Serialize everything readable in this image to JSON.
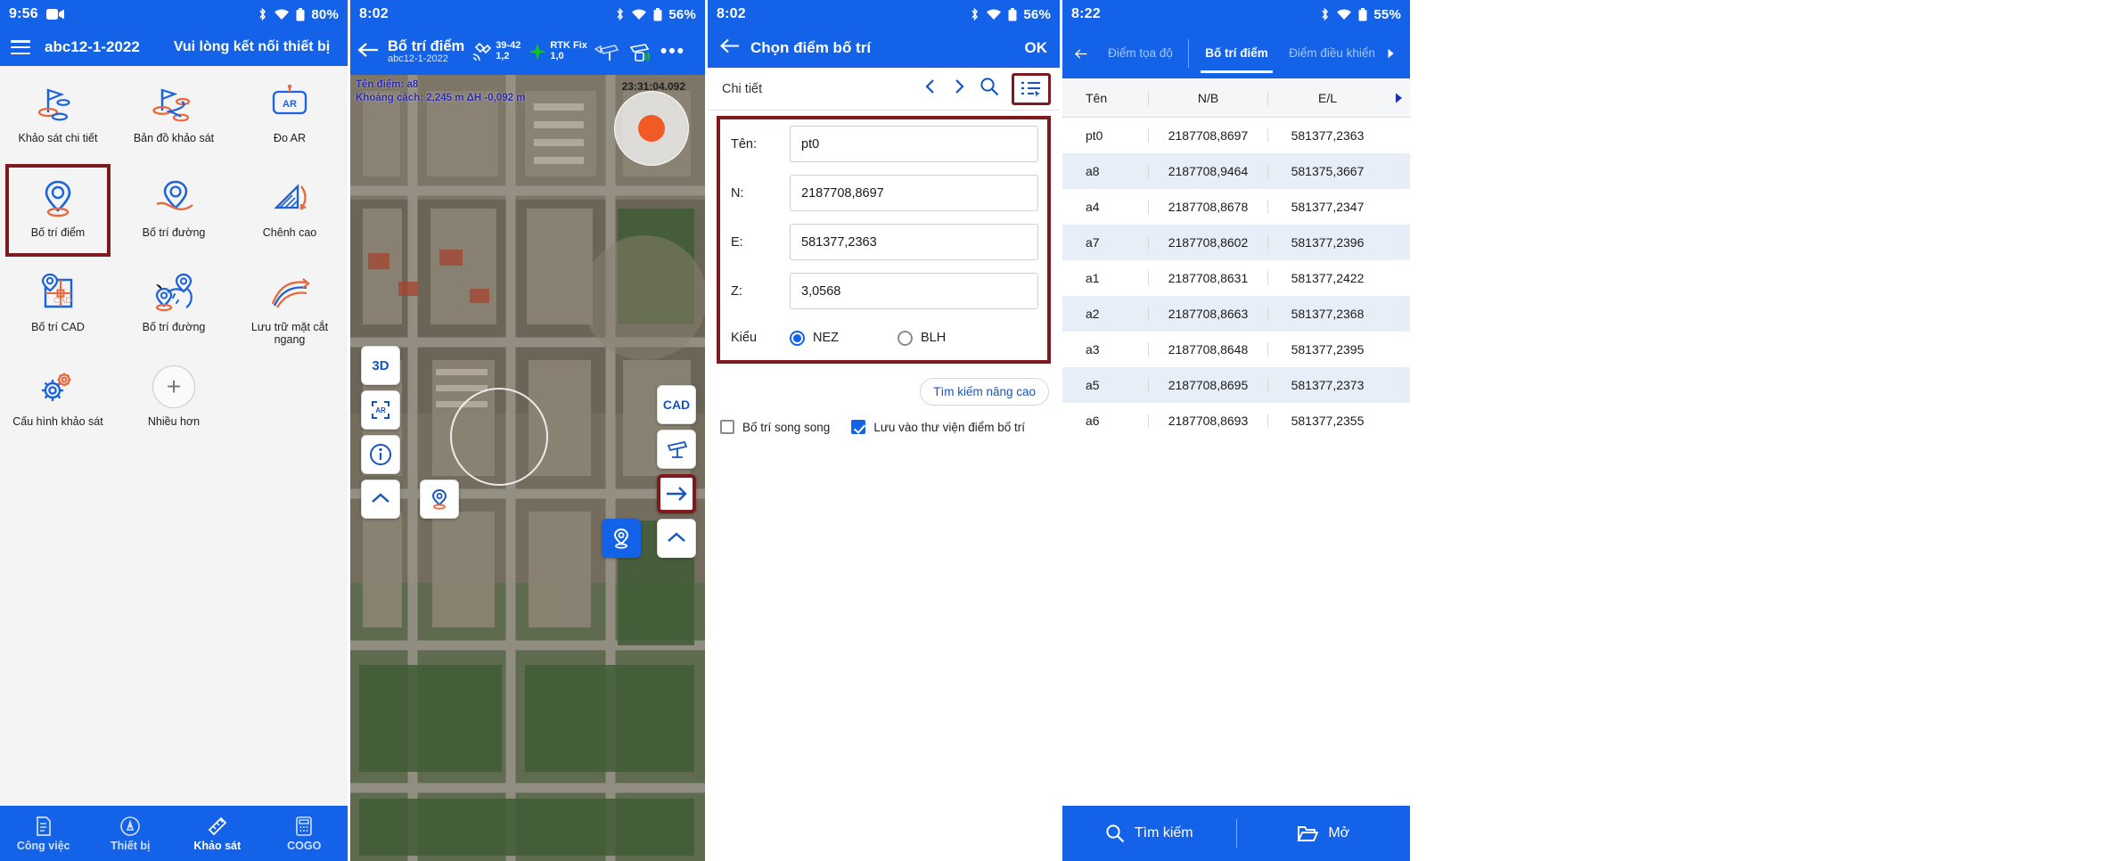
{
  "panel1": {
    "status": {
      "clock": "9:56",
      "battery": "80%",
      "rec_icon": "video-record-icon",
      "bt_icon": "bluetooth-icon",
      "wifi_icon": "wifi-icon",
      "battery_icon": "battery-icon"
    },
    "appbar": {
      "menu_icon": "hamburger-menu-icon",
      "project": "abc12-1-2022",
      "hint": "Vui lòng kết nối thiết bị"
    },
    "grid": [
      {
        "label": "Khảo sát chi tiết",
        "icon": "flag-survey-points-icon",
        "selected": false
      },
      {
        "label": "Bản đồ khảo sát",
        "icon": "flag-survey-map-icon",
        "selected": false
      },
      {
        "label": "Đo AR",
        "icon": "ar-measure-icon",
        "selected": false
      },
      {
        "label": "Bố trí điểm",
        "icon": "pin-stakeout-point-icon",
        "selected": true
      },
      {
        "label": "Bố trí đường",
        "icon": "pin-stakeout-line-icon",
        "selected": false
      },
      {
        "label": "Chênh cao",
        "icon": "elevation-difference-icon",
        "selected": false
      },
      {
        "label": "Bố trí CAD",
        "icon": "cad-stakeout-icon",
        "selected": false
      },
      {
        "label": "Bố trí đường",
        "icon": "road-stakeout-icon",
        "selected": false
      },
      {
        "label": "Lưu trữ mặt cắt ngang",
        "icon": "cross-section-storage-icon",
        "selected": false
      },
      {
        "label": "Cấu hình khảo sát",
        "icon": "gears-survey-config-icon",
        "selected": false
      },
      {
        "label": "Nhiều hơn",
        "icon": "plus-more-icon",
        "selected": false
      }
    ],
    "bottomnav": [
      {
        "label": "Công việc",
        "icon": "document-job-icon",
        "active": false
      },
      {
        "label": "Thiết bị",
        "icon": "device-antenna-icon",
        "active": false
      },
      {
        "label": "Khảo sát",
        "icon": "survey-ruler-icon",
        "active": true
      },
      {
        "label": "COGO",
        "icon": "cogo-calculator-icon",
        "active": false
      }
    ]
  },
  "panel2": {
    "status": {
      "clock": "8:02",
      "battery": "56%"
    },
    "appbar": {
      "back_icon": "back-arrow-icon",
      "title": "Bố trí điểm",
      "subtitle": "abc12-1-2022",
      "satellite_icon": "satellite-icon",
      "satellite_line1": "39-42",
      "satellite_line2": "1,2",
      "fix_icon": "green-cross-fix-icon",
      "fix_line1": "RTK Fix",
      "fix_line2": "1,0",
      "rover_icon": "rover-antenna-icon",
      "base_icon": "base-station-icon",
      "more_icon": "more-dots-icon"
    },
    "map": {
      "overlay_line1": "Tên điểm: a8",
      "overlay_line2": "Khoảng cách: 2,245 m  ΔH -0,092 m",
      "time_label": "23:31:04.092",
      "buttons": [
        {
          "name": "3d-view-button",
          "label": "3D"
        },
        {
          "name": "ar-view-button",
          "label": "AR"
        },
        {
          "name": "info-button",
          "label": "i"
        },
        {
          "name": "collapse-left-button",
          "label": "⌃"
        },
        {
          "name": "point-marker-button",
          "label": "pin"
        },
        {
          "name": "cad-button",
          "label": "CAD"
        },
        {
          "name": "antenna-button",
          "label": "antenna"
        },
        {
          "name": "next-point-button",
          "label": "→"
        },
        {
          "name": "collapse-right-button",
          "label": "⌃"
        },
        {
          "name": "stakeout-point-button",
          "label": "pin"
        }
      ]
    }
  },
  "panel3": {
    "status": {
      "clock": "8:02",
      "battery": "56%"
    },
    "appbar": {
      "back_icon": "back-arrow-icon",
      "title": "Chọn điểm bố trí",
      "ok": "OK"
    },
    "subbar": {
      "caption": "Chi tiết",
      "prev_icon": "chevron-left-icon",
      "next_icon": "chevron-right-icon",
      "search_icon": "search-icon",
      "list_icon": "list-select-icon"
    },
    "form": [
      {
        "label": "Tên:",
        "value": "pt0",
        "name": "point-name-field"
      },
      {
        "label": "N:",
        "value": "2187708,8697",
        "name": "north-field"
      },
      {
        "label": "E:",
        "value": "581377,2363",
        "name": "east-field"
      },
      {
        "label": "Z:",
        "value": "3,0568",
        "name": "elevation-field"
      }
    ],
    "kieu": {
      "label": "Kiểu",
      "options": [
        {
          "label": "NEZ",
          "checked": true
        },
        {
          "label": "BLH",
          "checked": false
        }
      ]
    },
    "advanced_search": "Tìm kiếm nâng cao",
    "checks": [
      {
        "label": "Bố trí song song",
        "checked": false,
        "name": "parallel-stakeout-checkbox"
      },
      {
        "label": "Lưu vào thư viện điểm bố trí",
        "checked": true,
        "name": "save-to-library-checkbox"
      }
    ]
  },
  "panel4": {
    "status": {
      "clock": "8:22",
      "battery": "55%"
    },
    "appbar": {
      "back_icon": "back-arrow-icon",
      "tabs": [
        {
          "label": "Điểm tọa độ",
          "active": false
        },
        {
          "label": "Bố trí điểm",
          "active": true
        },
        {
          "label": "Điểm điều khiển",
          "active": false
        }
      ],
      "next_icon": "chevron-right-icon"
    },
    "table": {
      "columns": [
        "Tên",
        "N/B",
        "E/L"
      ],
      "scroll_icon": "scroll-right-arrow-icon",
      "rows": [
        {
          "name": "pt0",
          "nb": "2187708,8697",
          "el": "581377,2363"
        },
        {
          "name": "a8",
          "nb": "2187708,9464",
          "el": "581375,3667"
        },
        {
          "name": "a4",
          "nb": "2187708,8678",
          "el": "581377,2347"
        },
        {
          "name": "a7",
          "nb": "2187708,8602",
          "el": "581377,2396"
        },
        {
          "name": "a1",
          "nb": "2187708,8631",
          "el": "581377,2422"
        },
        {
          "name": "a2",
          "nb": "2187708,8663",
          "el": "581377,2368"
        },
        {
          "name": "a3",
          "nb": "2187708,8648",
          "el": "581377,2395"
        },
        {
          "name": "a5",
          "nb": "2187708,8695",
          "el": "581377,2373"
        },
        {
          "name": "a6",
          "nb": "2187708,8693",
          "el": "581377,2355"
        }
      ]
    },
    "bottombar": [
      {
        "label": "Tìm kiếm",
        "icon": "search-icon",
        "name": "search-button"
      },
      {
        "label": "Mở",
        "icon": "folder-open-icon",
        "name": "open-button"
      }
    ]
  },
  "colors": {
    "brand": "#1362e8",
    "highlight": "#7d1a1f",
    "accent_orange": "#e8673c",
    "fix_green": "#14c41b"
  }
}
